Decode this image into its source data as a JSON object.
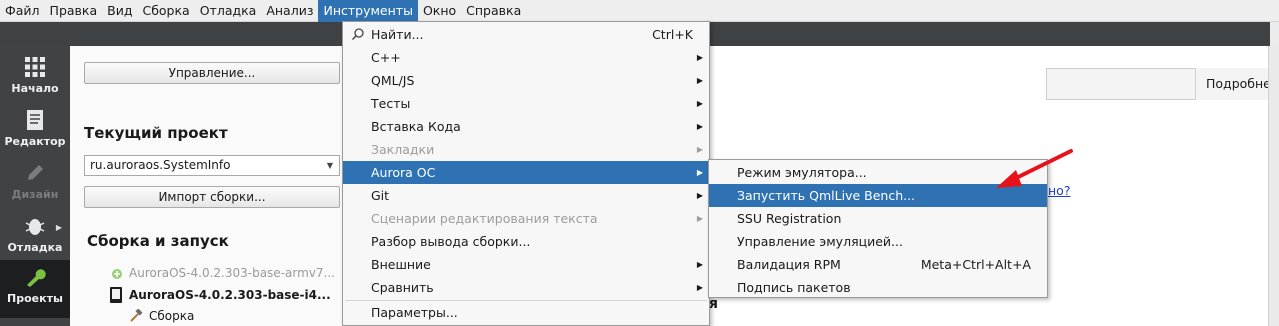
{
  "menubar": {
    "items": [
      {
        "label": "Файл"
      },
      {
        "label": "Правка"
      },
      {
        "label": "Вид"
      },
      {
        "label": "Сборка"
      },
      {
        "label": "Отладка"
      },
      {
        "label": "Анализ"
      },
      {
        "label": "Инструменты"
      },
      {
        "label": "Окно"
      },
      {
        "label": "Справка"
      }
    ],
    "active_index": 6
  },
  "modebar": {
    "items": [
      {
        "label": "Начало",
        "icon": "grid-icon",
        "state": "normal"
      },
      {
        "label": "Редактор",
        "icon": "document-icon",
        "state": "normal"
      },
      {
        "label": "Дизайн",
        "icon": "pencil-icon",
        "state": "disabled"
      },
      {
        "label": "Отладка",
        "icon": "bug-icon",
        "state": "normal"
      },
      {
        "label": "Проекты",
        "icon": "wrench-icon",
        "state": "selected"
      }
    ]
  },
  "panel": {
    "manage_button": "Управление...",
    "current_project_heading": "Текущий проект",
    "project_combo_value": "ru.auroraos.SystemInfo",
    "import_button": "Импорт сборки...",
    "build_run_heading": "Сборка и запуск",
    "kits": [
      {
        "label": "AuroraOS-4.0.2.303-base-armv7...",
        "state": "dim"
      },
      {
        "label": "AuroraOS-4.0.2.303-base-i4...",
        "state": "bold"
      },
      {
        "label": "Сборка",
        "state": "normal"
      }
    ]
  },
  "right": {
    "details_label": "Подробне",
    "link_tail": "но?",
    "heading_tail": "я"
  },
  "tools_menu": {
    "items": [
      {
        "label": "Найти...",
        "shortcut": "Ctrl+K",
        "submenu": false,
        "state": "normal",
        "icon": "search-icon"
      },
      {
        "label": "C++",
        "shortcut": "",
        "submenu": true,
        "state": "normal"
      },
      {
        "label": "QML/JS",
        "shortcut": "",
        "submenu": true,
        "state": "normal"
      },
      {
        "label": "Тесты",
        "shortcut": "",
        "submenu": true,
        "state": "normal"
      },
      {
        "label": "Вставка Кода",
        "shortcut": "",
        "submenu": true,
        "state": "normal"
      },
      {
        "label": "Закладки",
        "shortcut": "",
        "submenu": true,
        "state": "disabled"
      },
      {
        "label": "Aurora OC",
        "shortcut": "",
        "submenu": true,
        "state": "highlighted"
      },
      {
        "label": "Git",
        "shortcut": "",
        "submenu": true,
        "state": "normal"
      },
      {
        "label": "Сценарии редактирования текста",
        "shortcut": "",
        "submenu": true,
        "state": "disabled"
      },
      {
        "label": "Разбор вывода сборки...",
        "shortcut": "",
        "submenu": false,
        "state": "normal"
      },
      {
        "label": "Внешние",
        "shortcut": "",
        "submenu": true,
        "state": "normal"
      },
      {
        "label": "Сравнить",
        "shortcut": "",
        "submenu": true,
        "state": "normal"
      },
      {
        "label": "Параметры...",
        "shortcut": "",
        "submenu": false,
        "state": "normal"
      }
    ]
  },
  "aurora_submenu": {
    "items": [
      {
        "label": "Режим эмулятора...",
        "shortcut": "",
        "state": "normal"
      },
      {
        "label": "Запустить QmlLive Bench...",
        "shortcut": "",
        "state": "highlighted"
      },
      {
        "label": "SSU Registration",
        "shortcut": "",
        "state": "normal"
      },
      {
        "label": "Управление эмуляцией...",
        "shortcut": "",
        "state": "normal"
      },
      {
        "label": "Валидация RPM",
        "shortcut": "Meta+Ctrl+Alt+A",
        "state": "normal"
      },
      {
        "label": "Подпись пакетов",
        "shortcut": "",
        "state": "normal"
      }
    ]
  },
  "colors": {
    "highlight": "#2f72b3",
    "annotation_arrow": "#e8121b",
    "modebar_bg": "#404244"
  }
}
